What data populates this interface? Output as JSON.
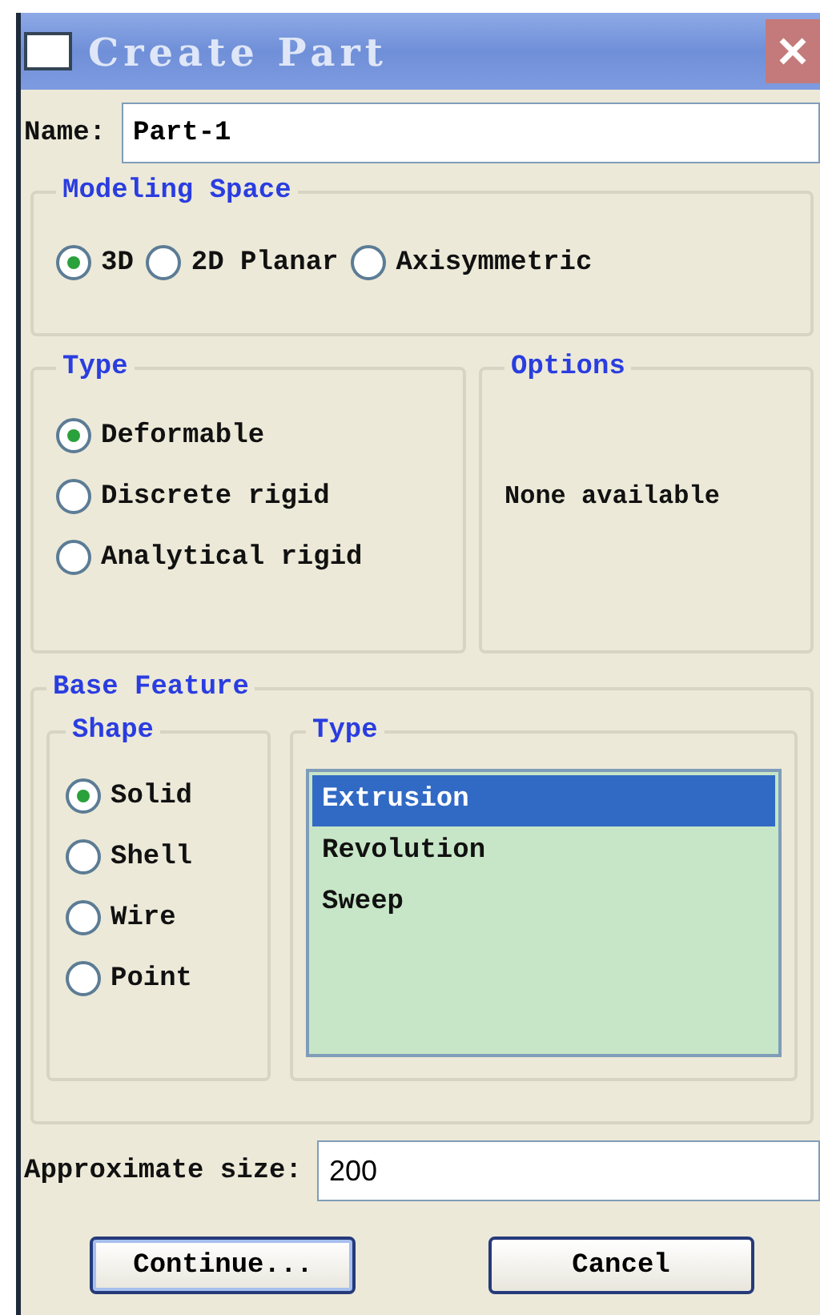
{
  "window": {
    "title": "Create Part"
  },
  "name_field": {
    "label": "Name:",
    "value": "Part-1"
  },
  "modeling_space": {
    "title": "Modeling Space",
    "options": [
      {
        "label": "3D",
        "selected": true
      },
      {
        "label": "2D Planar",
        "selected": false
      },
      {
        "label": "Axisymmetric",
        "selected": false
      }
    ]
  },
  "type": {
    "title": "Type",
    "options": [
      {
        "label": "Deformable",
        "selected": true
      },
      {
        "label": "Discrete rigid",
        "selected": false
      },
      {
        "label": "Analytical rigid",
        "selected": false
      }
    ]
  },
  "options": {
    "title": "Options",
    "text": "None available"
  },
  "base_feature": {
    "title": "Base Feature",
    "shape": {
      "title": "Shape",
      "options": [
        {
          "label": "Solid",
          "selected": true
        },
        {
          "label": "Shell",
          "selected": false
        },
        {
          "label": "Wire",
          "selected": false
        },
        {
          "label": "Point",
          "selected": false
        }
      ]
    },
    "type": {
      "title": "Type",
      "items": [
        {
          "label": "Extrusion",
          "selected": true
        },
        {
          "label": "Revolution",
          "selected": false
        },
        {
          "label": "Sweep",
          "selected": false
        }
      ]
    }
  },
  "size_field": {
    "label": "Approximate size:",
    "value": "200"
  },
  "buttons": [
    "Continue...",
    "Cancel"
  ]
}
